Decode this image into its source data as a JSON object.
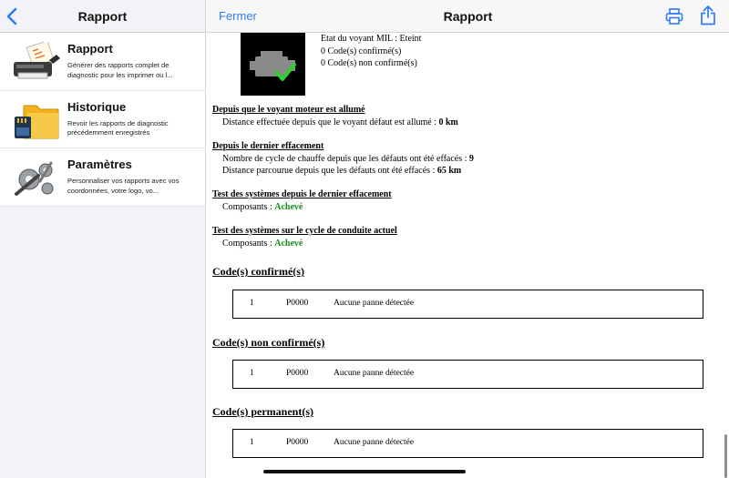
{
  "sidebar": {
    "title": "Rapport",
    "items": [
      {
        "title": "Rapport",
        "desc": "Générer des rapports complet de diagnostic pour les imprimer ou l...",
        "icon": "printer-report-icon"
      },
      {
        "title": "Historique",
        "desc": "Revoir les rapports de diagnostic précédemment enregistrés",
        "icon": "folder-sdcard-icon"
      },
      {
        "title": "Paramètres",
        "desc": "Personnaliser vos rapports avec vos coordonnées, votre logo, vo...",
        "icon": "gears-icon"
      }
    ]
  },
  "nav": {
    "close_label": "Fermer",
    "title": "Rapport",
    "print_icon": "printer-icon",
    "share_icon": "share-icon"
  },
  "report": {
    "mil": {
      "status": "Etat du voyant MIL : Eteint",
      "confirmed": "0 Code(s) confirmé(s)",
      "unconfirmed": "0 Code(s) non confirmé(s)"
    },
    "since_mil": {
      "heading": "Depuis que le voyant moteur est allumé",
      "distance_label": "Distance effectuée depuis que le voyant défaut est allumé : ",
      "distance_value": "0 km"
    },
    "since_clear": {
      "heading": "Depuis le dernier effacement",
      "warmups_label": "Nombre de cycle de chauffe depuis que les défauts ont été effacés : ",
      "warmups_value": "9",
      "distance_label": "Distance parcourue depuis que les défauts ont été effacés : ",
      "distance_value": "65 km"
    },
    "test_since_clear": {
      "heading": "Test des systèmes depuis le dernier effacement",
      "label": "Composants : ",
      "value": "Achevé"
    },
    "test_current": {
      "heading": "Test des systèmes sur le cycle de conduite actuel",
      "label": "Composants : ",
      "value": "Achevé"
    },
    "code_sections": [
      {
        "title": "Code(s) confirmé(s)",
        "index": "1",
        "code": "P0000",
        "desc": "Aucune panne détectée"
      },
      {
        "title": "Code(s) non confirmé(s)",
        "index": "1",
        "code": "P0000",
        "desc": "Aucune panne détectée"
      },
      {
        "title": "Code(s) permanent(s)",
        "index": "1",
        "code": "P0000",
        "desc": "Aucune panne détectée"
      }
    ]
  },
  "colors": {
    "accent": "#2f7cf6",
    "status_ok": "#1b8f1b"
  }
}
